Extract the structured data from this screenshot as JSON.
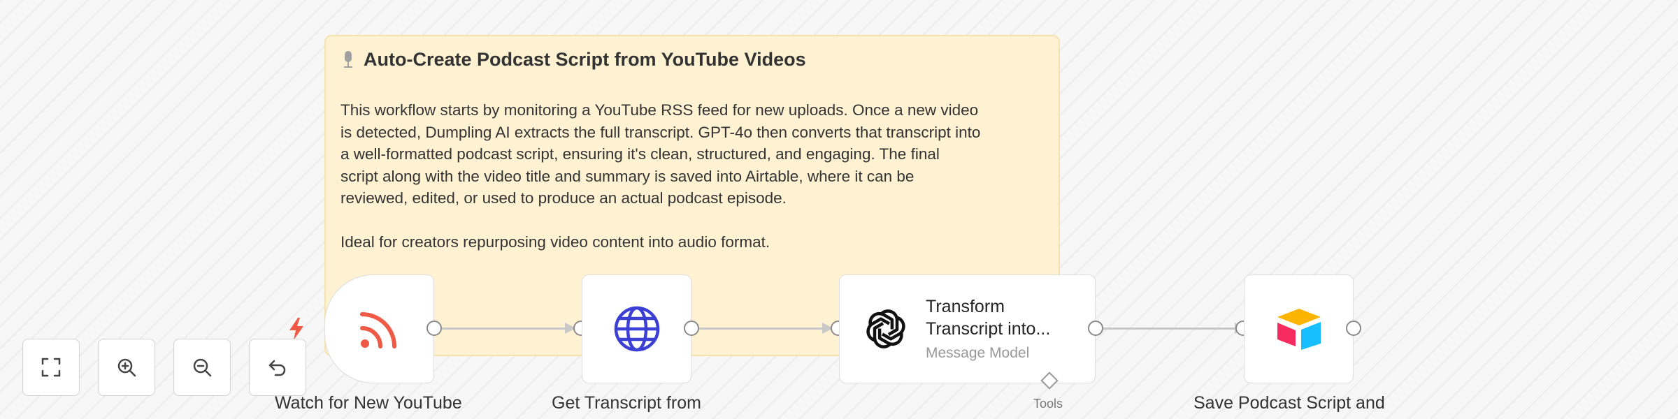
{
  "sticky_note": {
    "title": "Auto-Create Podcast Script from YouTube Videos",
    "lines": [
      "This workflow starts by monitoring a YouTube RSS feed for new uploads. Once a new video",
      "is detected, Dumpling AI extracts the full transcript. GPT-4o then converts that transcript into",
      "a well-formatted podcast script, ensuring it's clean, structured, and engaging. The final",
      "script along with the video title and summary is saved into Airtable, where it can be",
      "reviewed, edited, or used to produce an actual podcast episode."
    ],
    "closing": "Ideal for creators repurposing video content into audio format."
  },
  "nodes": {
    "rss": {
      "label": "Watch for New YouTube",
      "icon": "rss-icon"
    },
    "http": {
      "label": "Get Transcript from",
      "icon": "globe-icon"
    },
    "openai": {
      "title_line1": "Transform",
      "title_line2": "Transcript into...",
      "subtitle": "Message Model",
      "icon": "openai-icon",
      "tools_label": "Tools"
    },
    "airtable": {
      "label": "Save Podcast Script and",
      "icon": "airtable-icon"
    }
  },
  "colors": {
    "rss": "#ef5a46",
    "globe": "#3b3fd4",
    "sticky_bg": "#fff2d2",
    "trigger_bolt": "#ef5a46",
    "airtable_yellow": "#fcb400",
    "airtable_blue": "#18bfff",
    "airtable_red": "#f82b60"
  },
  "controls": {
    "fit": "fit-view-button",
    "zoom_in": "zoom-in-button",
    "zoom_out": "zoom-out-button",
    "reset": "reset-zoom-button"
  }
}
